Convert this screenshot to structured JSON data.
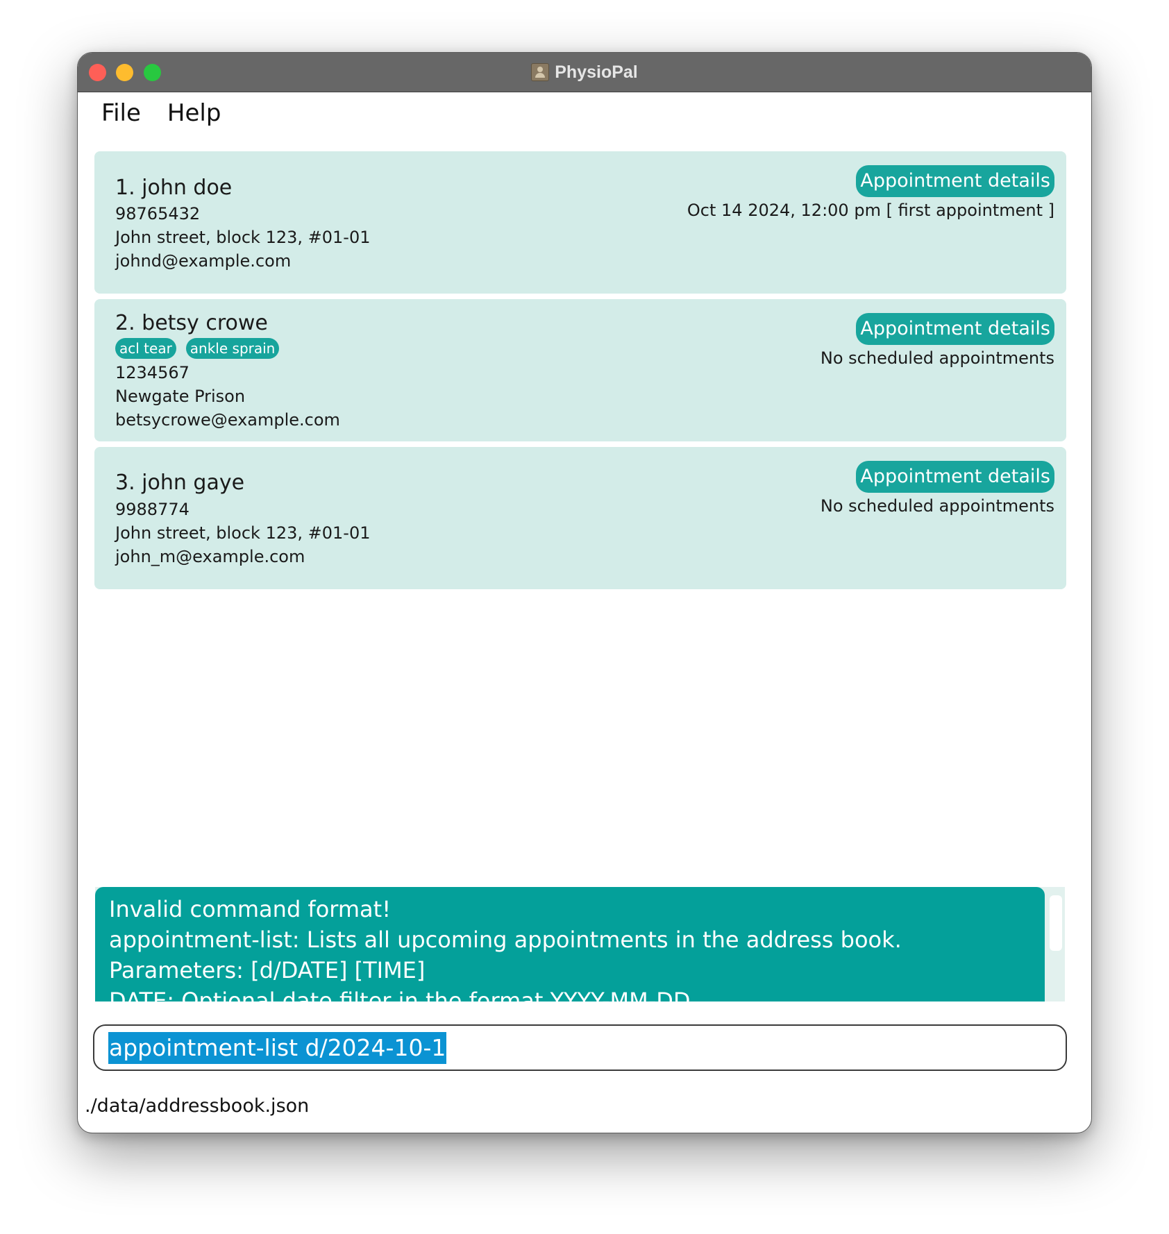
{
  "window": {
    "title": "PhysioPal"
  },
  "menu": {
    "file": "File",
    "help": "Help"
  },
  "patients": [
    {
      "name": "1. john doe",
      "tags": [],
      "phone": "98765432",
      "address": "John street, block 123, #01-01",
      "email": "johnd@example.com",
      "appointment_button": "Appointment details",
      "appointment_info": "Oct 14 2024, 12:00 pm [ first appointment ]"
    },
    {
      "name": "2. betsy crowe",
      "tags": [
        "acl tear",
        "ankle sprain"
      ],
      "phone": "1234567",
      "address": "Newgate Prison",
      "email": "betsycrowe@example.com",
      "appointment_button": "Appointment details",
      "appointment_info": "No scheduled appointments"
    },
    {
      "name": "3. john gaye",
      "tags": [],
      "phone": "9988774",
      "address": "John street, block 123, #01-01",
      "email": "john_m@example.com",
      "appointment_button": "Appointment details",
      "appointment_info": "No scheduled appointments"
    }
  ],
  "result": {
    "lines": [
      "Invalid command format!",
      "appointment-list: Lists all upcoming appointments in the address book.",
      "Parameters: [d/DATE] [TIME]",
      "DATE: Optional date filter in the format YYYY-MM-DD"
    ]
  },
  "command": {
    "value": "appointment-list d/2024-10-1"
  },
  "status": {
    "file_path": "./data/addressbook.json"
  },
  "colors": {
    "card_bg": "#d3ece8",
    "accent": "#18a59d",
    "result_bg": "#04a09a",
    "selection": "#0b93d3"
  }
}
